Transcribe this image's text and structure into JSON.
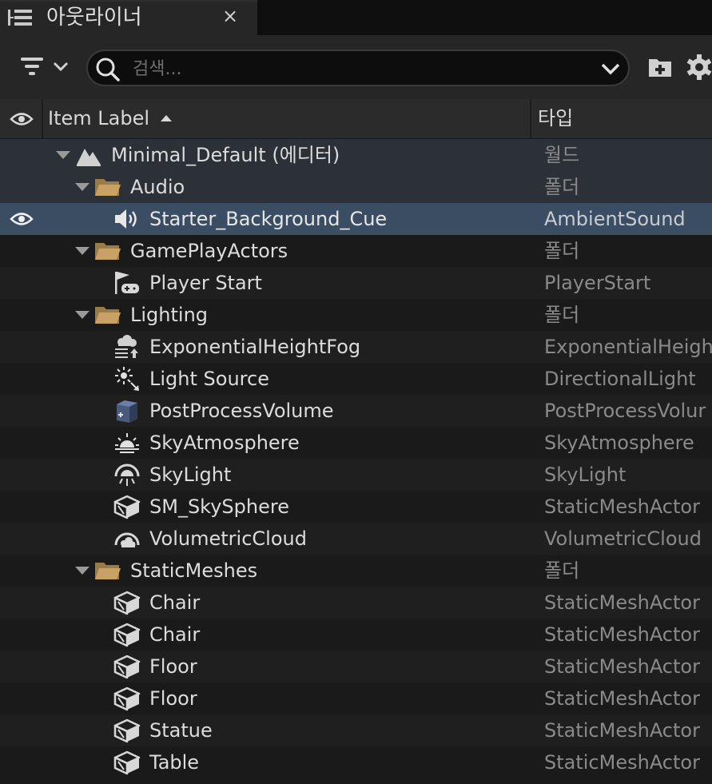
{
  "tab": {
    "title": "아웃라이너",
    "close": "×"
  },
  "search": {
    "placeholder": "검색...",
    "value": ""
  },
  "header": {
    "item_label": "Item Label",
    "type": "타입"
  },
  "colors": {
    "selected_row": "#3b4d63",
    "world_row": "#2c3138",
    "folder": "#c8a264"
  },
  "rows": [
    {
      "label": "Minimal_Default (에디터)",
      "type": "월드",
      "icon": "world-icon"
    },
    {
      "label": "Audio",
      "type": "폴더",
      "icon": "folder-icon"
    },
    {
      "label": "Starter_Background_Cue",
      "type": "AmbientSound",
      "icon": "speaker-icon",
      "selected": true
    },
    {
      "label": "GamePlayActors",
      "type": "폴더",
      "icon": "folder-icon"
    },
    {
      "label": "Player Start",
      "type": "PlayerStart",
      "icon": "player-start-icon"
    },
    {
      "label": "Lighting",
      "type": "폴더",
      "icon": "folder-icon"
    },
    {
      "label": "ExponentialHeightFog",
      "type": "ExponentialHeigh",
      "icon": "fog-icon"
    },
    {
      "label": "Light Source",
      "type": "DirectionalLight",
      "icon": "directional-light-icon"
    },
    {
      "label": "PostProcessVolume",
      "type": "PostProcessVolur",
      "icon": "post-process-icon"
    },
    {
      "label": "SkyAtmosphere",
      "type": "SkyAtmosphere",
      "icon": "sky-atmosphere-icon"
    },
    {
      "label": "SkyLight",
      "type": "SkyLight",
      "icon": "sky-light-icon"
    },
    {
      "label": "SM_SkySphere",
      "type": "StaticMeshActor",
      "icon": "static-mesh-icon"
    },
    {
      "label": "VolumetricCloud",
      "type": "VolumetricCloud",
      "icon": "cloud-icon"
    },
    {
      "label": "StaticMeshes",
      "type": "폴더",
      "icon": "folder-icon"
    },
    {
      "label": "Chair",
      "type": "StaticMeshActor",
      "icon": "static-mesh-icon"
    },
    {
      "label": "Chair",
      "type": "StaticMeshActor",
      "icon": "static-mesh-icon"
    },
    {
      "label": "Floor",
      "type": "StaticMeshActor",
      "icon": "static-mesh-icon"
    },
    {
      "label": "Floor",
      "type": "StaticMeshActor",
      "icon": "static-mesh-icon"
    },
    {
      "label": "Statue",
      "type": "StaticMeshActor",
      "icon": "static-mesh-icon"
    },
    {
      "label": "Table",
      "type": "StaticMeshActor",
      "icon": "static-mesh-icon"
    }
  ]
}
